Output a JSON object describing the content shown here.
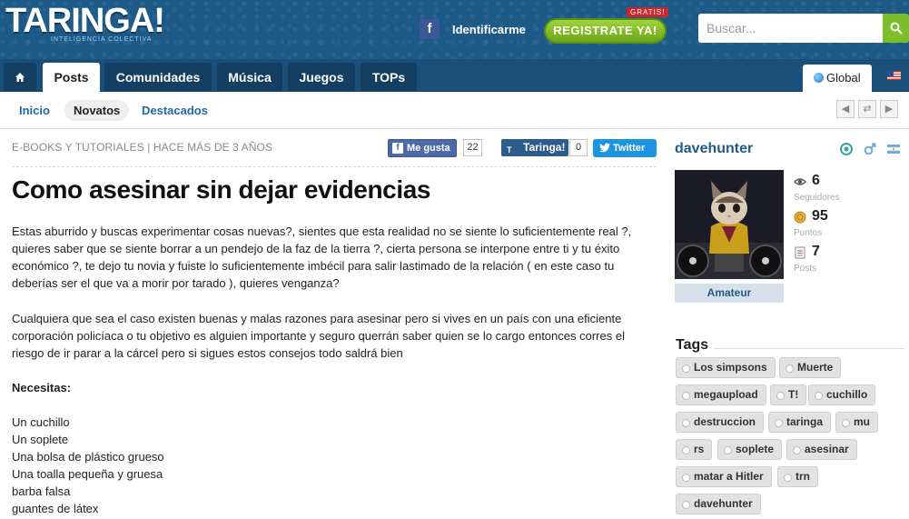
{
  "header": {
    "logo": "TARINGA!",
    "logo_sub": "INTELIGENCIA COLECTIVA",
    "identify_label": "Identificarme",
    "register_label": "REGISTRATE YA!",
    "register_badge": "GRATIS!",
    "search_placeholder": "Buscar..."
  },
  "main_nav": {
    "tabs": [
      "Posts",
      "Comunidades",
      "Música",
      "Juegos",
      "TOPs"
    ],
    "global_label": "Global"
  },
  "sub_nav": {
    "items": [
      "Inicio",
      "Novatos",
      "Destacados"
    ]
  },
  "post": {
    "meta": "E-BOOKS Y TUTORIALES | HACE MÁS DE 3 AÑOS",
    "like_label": "Me gusta",
    "like_count": "22",
    "taringa_label": "Taringa!",
    "taringa_count": "0",
    "twitter_label": "Twitter",
    "title": "Como asesinar sin dejar evidencias",
    "paragraph1": "Estas aburrido y buscas experimentar cosas nuevas?, sientes que esta realidad no se siente lo suficientemente real ?, quieres saber que se siente borrar a un pendejo de la faz de la tierra ?, cierta persona se interpone entre ti y tu éxito económico ?, te dejo tu novia y fuiste lo suficientemente imbécil para salir lastimado de la relación ( en este caso tu deberías ser el que va a morir por tarado ), quieres venganza?",
    "paragraph2": "Cualquiera que sea el caso existen buenas y malas razones para asesinar pero si vives en un país con una eficiente corporación policíaca o tu objetivo es alguien importante y seguro querrán saber quien se lo cargo entonces corres el riesgo de ir parar a la cárcel pero si sigues estos consejos todo saldrá bien",
    "needs_heading": "Necesitas:",
    "needs_list": [
      "Un cuchillo",
      "Un soplete",
      "Una bolsa de plástico grueso",
      "Una toalla pequeña y gruesa",
      "barba falsa",
      "guantes de látex"
    ]
  },
  "sidebar": {
    "username": "davehunter",
    "rank": "Amateur",
    "followers": "6",
    "followers_label": "Seguidores",
    "points": "95",
    "points_label": "Puntos",
    "posts": "7",
    "posts_label": "Posts",
    "tags_title": "Tags",
    "tags": [
      "Los simpsons",
      "Muerte",
      "megaupload",
      "T!",
      "cuchillo",
      "destruccion",
      "taringa",
      "mu",
      "rs",
      "soplete",
      "asesinar",
      "matar a Hitler",
      "trn",
      "davehunter"
    ]
  }
}
